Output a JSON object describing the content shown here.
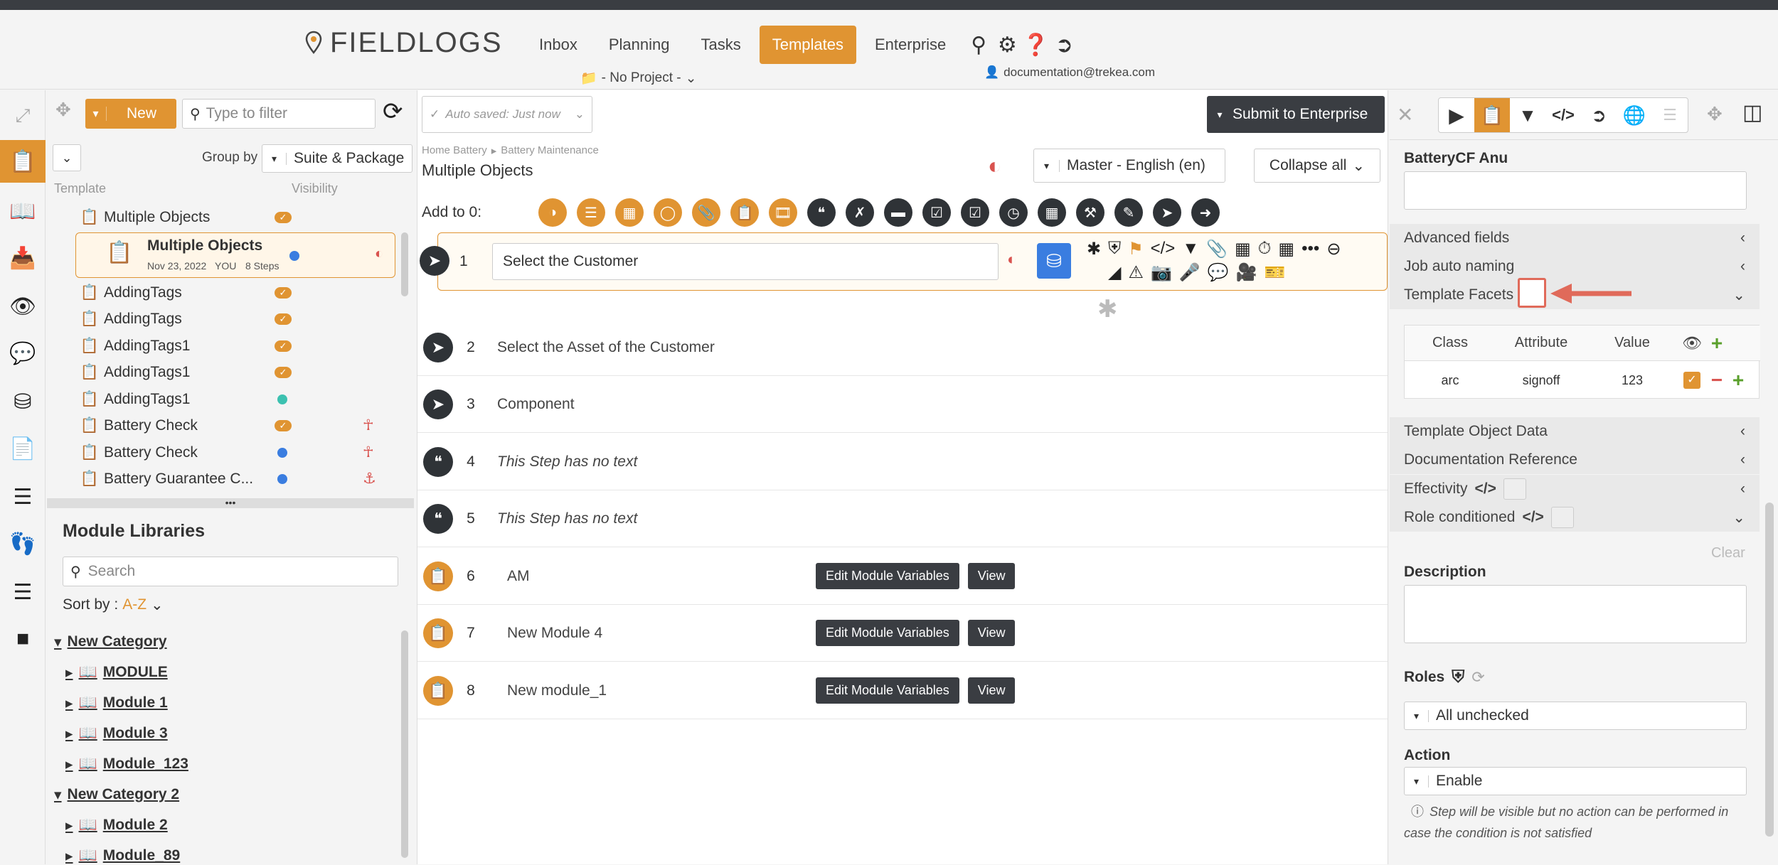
{
  "header": {
    "logo_text": "FIELDLOGS",
    "nav": [
      {
        "label": "Inbox"
      },
      {
        "label": "Planning"
      },
      {
        "label": "Tasks"
      },
      {
        "label": "Templates"
      },
      {
        "label": "Enterprise"
      }
    ],
    "project": "- No Project -",
    "user": "documentation@trekea.com"
  },
  "left": {
    "new_label": "New",
    "filter_placeholder": "Type to filter",
    "group_by_label": "Group by",
    "group_by_value": "Suite & Package",
    "col_template": "Template",
    "col_visibility": "Visibility",
    "items": [
      {
        "name": "Multiple Objects",
        "vis": "check"
      },
      {
        "name": "Multiple Objects",
        "date": "Nov 23, 2022",
        "who": "YOU",
        "steps": "8 Steps",
        "vis": "blue",
        "selected": true
      },
      {
        "name": "AddingTags",
        "vis": "check"
      },
      {
        "name": "AddingTags",
        "vis": "check"
      },
      {
        "name": "AddingTags1",
        "vis": "check"
      },
      {
        "name": "AddingTags1",
        "vis": "check"
      },
      {
        "name": "AddingTags1",
        "vis": "teal"
      },
      {
        "name": "Battery Check",
        "vis": "check"
      },
      {
        "name": "Battery Check",
        "vis": "blue"
      },
      {
        "name": "Battery Guarantee C...",
        "vis": "blue"
      }
    ],
    "modules_title": "Module Libraries",
    "modules_search": "Search",
    "sort_label": "Sort by :",
    "sort_value": "A-Z",
    "tree": [
      {
        "label": "New Category",
        "level": 0
      },
      {
        "label": "MODULE",
        "level": 1
      },
      {
        "label": "Module 1",
        "level": 1
      },
      {
        "label": "Module 3",
        "level": 1
      },
      {
        "label": "Module_123",
        "level": 1
      },
      {
        "label": "New Category 2",
        "level": 0
      },
      {
        "label": "Module 2",
        "level": 1
      },
      {
        "label": "Module_89",
        "level": 1
      }
    ]
  },
  "center": {
    "autosave": "Auto saved: Just now",
    "submit": "Submit to Enterprise",
    "breadcrumb1": "Home Battery",
    "breadcrumb2": "Battery Maintenance",
    "title": "Multiple Objects",
    "language": "Master - English (en)",
    "collapse": "Collapse all",
    "add_to": "Add to 0:",
    "steps": [
      {
        "num": "1",
        "text": "Select the Customer",
        "icon": "share"
      },
      {
        "num": "2",
        "text": "Select the Asset of the Customer",
        "icon": "share"
      },
      {
        "num": "3",
        "text": "Component",
        "icon": "share"
      },
      {
        "num": "4",
        "text": "This Step has no text",
        "icon": "quote",
        "italic": true
      },
      {
        "num": "5",
        "text": "This Step has no text",
        "icon": "quote",
        "italic": true
      },
      {
        "num": "6",
        "text": "AM",
        "icon": "module"
      },
      {
        "num": "7",
        "text": "New Module 4",
        "icon": "module"
      },
      {
        "num": "8",
        "text": "New module_1",
        "icon": "module"
      }
    ],
    "edit_module": "Edit Module Variables",
    "view": "View"
  },
  "right": {
    "field_title": "BatteryCF Anu",
    "advanced": "Advanced fields",
    "auto_naming": "Job auto naming",
    "facets": "Template Facets",
    "tbl_class": "Class",
    "tbl_attr": "Attribute",
    "tbl_value": "Value",
    "row_class": "arc",
    "row_attr": "signoff",
    "row_value": "123",
    "object_data": "Template Object Data",
    "doc_ref": "Documentation Reference",
    "effectivity": "Effectivity",
    "role_cond": "Role conditioned",
    "clear": "Clear",
    "description": "Description",
    "roles": "Roles",
    "roles_value": "All unchecked",
    "action": "Action",
    "action_value": "Enable",
    "note": "Step will be visible but no action can be performed in case the condition is not satisfied"
  },
  "colors": {
    "accent": "#e09432",
    "dark": "#2f3337",
    "red": "#d9534f"
  }
}
